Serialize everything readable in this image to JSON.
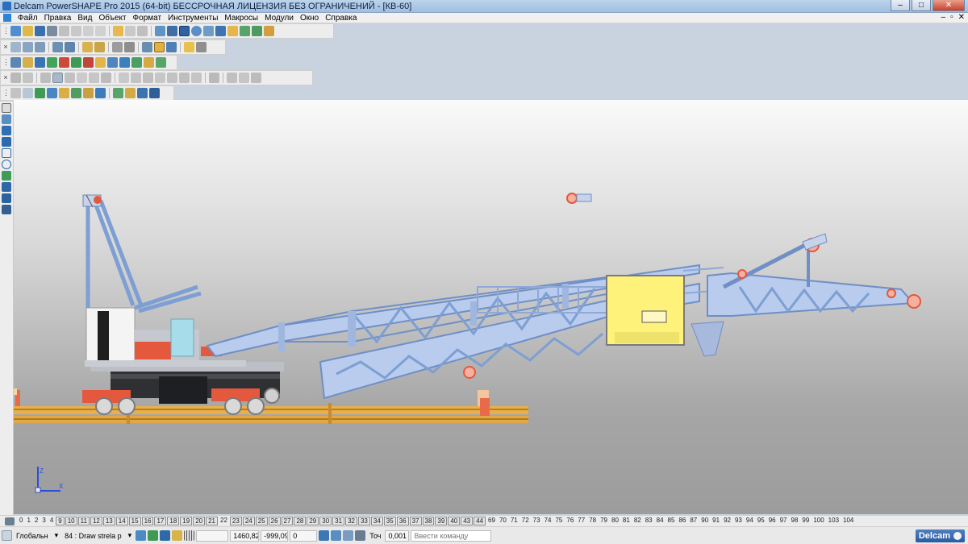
{
  "window": {
    "title": "Delcam PowerSHAPE Pro 2015 (64-bit) БЕССРОЧНАЯ ЛИЦЕНЗИЯ БЕЗ ОГРАНИЧЕНИЙ - [КВ-60]",
    "minimize": "–",
    "maximize": "□",
    "close": "✕"
  },
  "menu": {
    "items": [
      "Файл",
      "Правка",
      "Вид",
      "Объект",
      "Формат",
      "Инструменты",
      "Макросы",
      "Модули",
      "Окно",
      "Справка"
    ],
    "mdi": [
      "–",
      "▫",
      "✕"
    ]
  },
  "toolbars": {
    "close_glyph": "×",
    "grip_glyph": "⋮"
  },
  "viewport": {
    "axis_labels": {
      "z": "Z",
      "x": "X"
    }
  },
  "levels": {
    "plain": [
      "0",
      "1",
      "2",
      "3",
      "4"
    ],
    "boxed_a": [
      "9",
      "10",
      "11",
      "12",
      "13",
      "14",
      "15",
      "16",
      "17",
      "18",
      "19",
      "20",
      "21"
    ],
    "plain_mid": [
      "22"
    ],
    "boxed_b": [
      "23",
      "24",
      "25",
      "26",
      "27",
      "28",
      "29",
      "30",
      "31",
      "32",
      "33",
      "34",
      "35",
      "36",
      "37",
      "38",
      "39",
      "40",
      "43",
      "44"
    ],
    "plain_end": [
      "69",
      "70",
      "71",
      "72",
      "73",
      "74",
      "75",
      "76",
      "77",
      "78",
      "79",
      "80",
      "81",
      "82",
      "83",
      "84",
      "85",
      "86",
      "87",
      "90",
      "91",
      "92",
      "93",
      "94",
      "95",
      "96",
      "97",
      "98",
      "99",
      "100",
      "103",
      "104"
    ]
  },
  "status": {
    "workplane": "Глобальн",
    "level_select": "84 : Draw strela p",
    "coord_x": "1460,82",
    "coord_y": "-999,09",
    "coord_z": "0",
    "tolerance_label": "Точ",
    "tolerance_value": "0,001",
    "command_placeholder": "Ввести команду",
    "brand": "Delcam"
  }
}
